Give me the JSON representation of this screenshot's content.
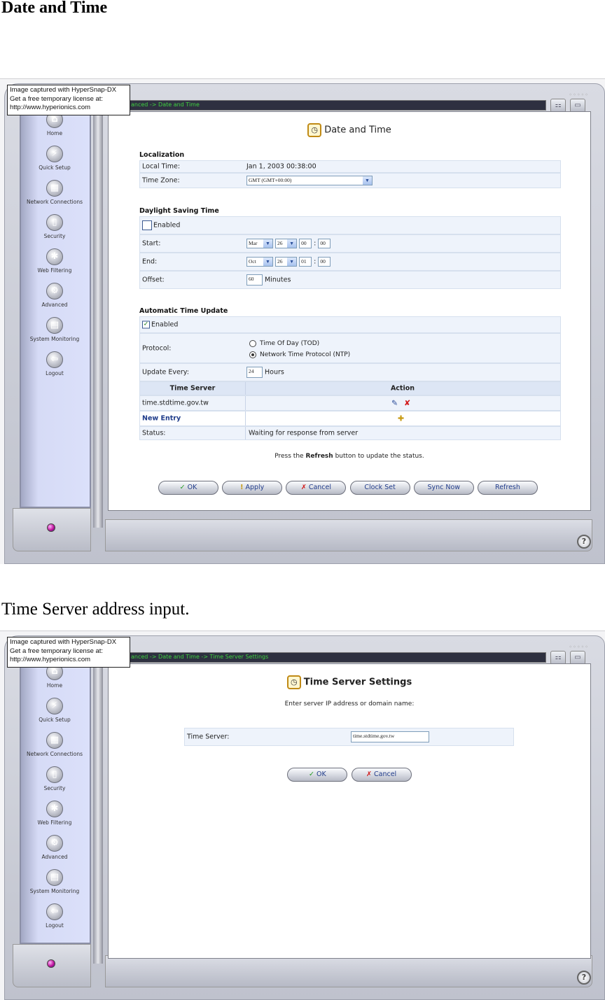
{
  "doc": {
    "heading": "Date and Time",
    "caption": "Time Server address input."
  },
  "watermark": [
    "Image captured with HyperSnap-DX",
    "Get a free temporary license at:",
    "http://www.hyperionics.com"
  ],
  "sidebar": [
    {
      "label": "Home",
      "icon": "home-icon"
    },
    {
      "label": "Quick Setup",
      "icon": "quick-setup-icon"
    },
    {
      "label": "Network Connections",
      "icon": "network-icon"
    },
    {
      "label": "Security",
      "icon": "lock-icon"
    },
    {
      "label": "Web Filtering",
      "icon": "web-filter-icon"
    },
    {
      "label": "Advanced",
      "icon": "advanced-icon"
    },
    {
      "label": "System Monitoring",
      "icon": "monitor-icon"
    },
    {
      "label": "Logout",
      "icon": "logout-icon"
    }
  ],
  "screen1": {
    "breadcrumb": "anced -> Date and Time",
    "title": "Date and Time",
    "localization": {
      "heading": "Localization",
      "local_time_label": "Local Time:",
      "local_time_value": "Jan 1, 2003 00:38:00",
      "time_zone_label": "Time Zone:",
      "time_zone_value": "GMT (GMT+00:00)"
    },
    "dst": {
      "heading": "Daylight Saving Time",
      "enabled_label": "Enabled",
      "enabled_checked": false,
      "start_label": "Start:",
      "start_month": "Mar",
      "start_day": "26",
      "start_hour": "00",
      "start_min": "00",
      "end_label": "End:",
      "end_month": "Oct",
      "end_day": "26",
      "end_hour": "01",
      "end_min": "00",
      "offset_label": "Offset:",
      "offset_value": "60",
      "offset_unit": "Minutes"
    },
    "auto": {
      "heading": "Automatic Time Update",
      "enabled_label": "Enabled",
      "enabled_checked": true,
      "protocol_label": "Protocol:",
      "protocol_tod": "Time Of Day (TOD)",
      "protocol_ntp": "Network Time Protocol (NTP)",
      "update_label": "Update Every:",
      "update_value": "24",
      "update_unit": "Hours"
    },
    "table": {
      "col_server": "Time Server",
      "col_action": "Action",
      "server": "time.stdtime.gov.tw",
      "new_entry": "New Entry",
      "status_label": "Status:",
      "status_value": "Waiting for response from server"
    },
    "note_pre": "Press the ",
    "note_bold": "Refresh",
    "note_post": " button to update the status.",
    "buttons": {
      "ok": "OK",
      "apply": "Apply",
      "cancel": "Cancel",
      "clock_set": "Clock Set",
      "sync_now": "Sync Now",
      "refresh": "Refresh"
    }
  },
  "screen2": {
    "breadcrumb": "anced -> Date and Time -> Time Server Settings",
    "title": "Time Server Settings",
    "instruction": "Enter server IP address or domain name:",
    "field_label": "Time Server:",
    "field_value": "time.stdtime.gov.tw",
    "buttons": {
      "ok": "OK",
      "cancel": "Cancel"
    }
  }
}
